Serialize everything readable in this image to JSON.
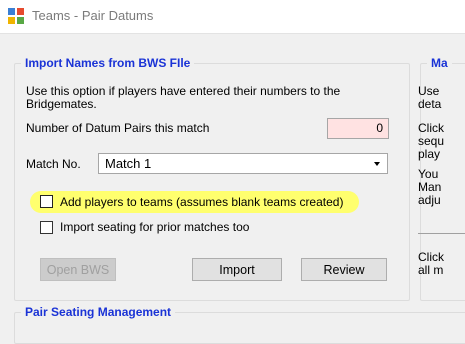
{
  "window": {
    "title": "Teams - Pair Datums"
  },
  "import_group": {
    "legend": "Import Names from BWS FIle",
    "description_line1": "Use this option if players have entered  their numbers to the",
    "description_line2": "Bridgemates.",
    "datum_pairs_label": "Number of Datum Pairs this match",
    "datum_pairs_value": "0",
    "match_label": "Match No.",
    "match_value": "Match 1",
    "add_players_label": "Add players to teams (assumes blank teams created)",
    "add_players_checked": false,
    "import_seating_label": "Import seating for prior matches too",
    "import_seating_checked": false,
    "open_bws_label": "Open BWS",
    "import_label": "Import",
    "review_label": "Review"
  },
  "right_group": {
    "legend": "Ma",
    "lines": [
      "Use",
      "deta",
      "Click",
      "sequ",
      "play",
      "You",
      "Man",
      "adju",
      "Click",
      "all m"
    ]
  },
  "seating_group": {
    "legend": "Pair Seating Management"
  },
  "colors": {
    "legend_blue": "#1a33d6",
    "highlight_yellow": "#ffff66",
    "number_box_bg": "#ffe2e2"
  }
}
